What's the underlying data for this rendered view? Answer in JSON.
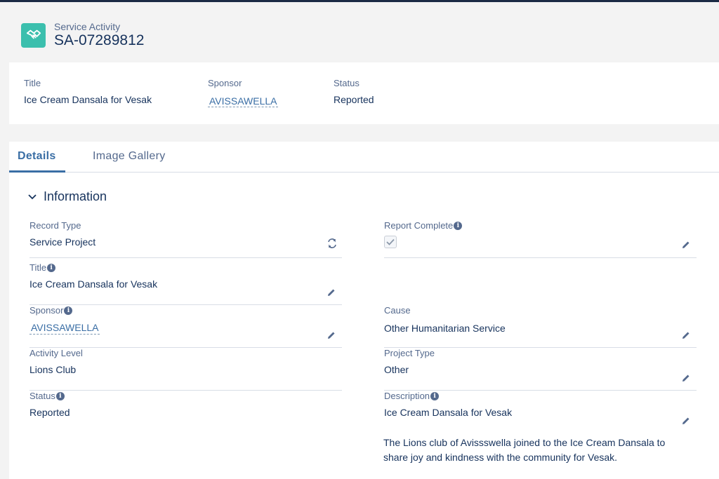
{
  "header": {
    "record_type": "Service Activity",
    "record_name": "SA-07289812",
    "icon": "handshake-icon",
    "icon_color": "#3bbfad"
  },
  "highlights": {
    "title_label": "Title",
    "title_value": "Ice Cream Dansala for Vesak",
    "sponsor_label": "Sponsor",
    "sponsor_value": "AVISSAWELLA",
    "status_label": "Status",
    "status_value": "Reported"
  },
  "tabs": [
    {
      "label": "Details",
      "active": true
    },
    {
      "label": "Image Gallery",
      "active": false
    }
  ],
  "section": {
    "title": "Information"
  },
  "fields": {
    "record_type": {
      "label": "Record Type",
      "value": "Service Project"
    },
    "report_complete": {
      "label": "Report Complete",
      "checked": true
    },
    "title": {
      "label": "Title",
      "value": "Ice Cream Dansala for Vesak"
    },
    "sponsor": {
      "label": "Sponsor",
      "value": "AVISSAWELLA"
    },
    "cause": {
      "label": "Cause",
      "value": "Other Humanitarian Service"
    },
    "activity_level": {
      "label": "Activity Level",
      "value": "Lions Club"
    },
    "project_type": {
      "label": "Project Type",
      "value": "Other"
    },
    "status": {
      "label": "Status",
      "value": "Reported"
    },
    "description": {
      "label": "Description",
      "value": "Ice Cream Dansala for Vesak",
      "body": "The Lions club of Avissswella joined to the Ice Cream Dansala to share joy and kindness with the community for Vesak."
    }
  },
  "colors": {
    "accent": "#3a6ea5",
    "label": "#54698d",
    "text": "#16325c",
    "page_bg": "#f3f3f3"
  }
}
